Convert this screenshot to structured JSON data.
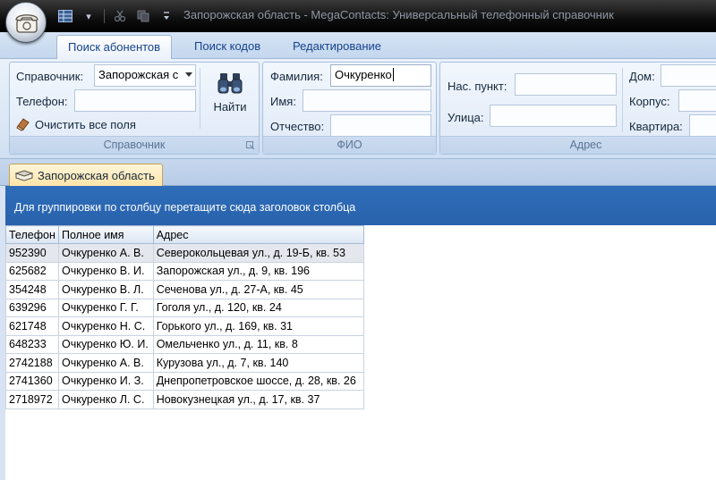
{
  "window": {
    "title": "Запорожская область - MegaContacts: Универсальный телефонный справочник"
  },
  "ribbon_tabs": [
    {
      "label": "Поиск абонентов",
      "active": true
    },
    {
      "label": "Поиск кодов",
      "active": false
    },
    {
      "label": "Редактирование",
      "active": false
    }
  ],
  "groups": {
    "directory": {
      "caption": "Справочник",
      "directory_label": "Справочник:",
      "directory_value": "Запорожская с",
      "phone_label": "Телефон:",
      "phone_value": "",
      "clear_label": "Очистить все поля",
      "find_label": "Найти"
    },
    "fio": {
      "caption": "ФИО",
      "surname_label": "Фамилия:",
      "surname_value": "Очкуренко",
      "name_label": "Имя:",
      "name_value": "",
      "patronymic_label": "Отчество:",
      "patronymic_value": ""
    },
    "address": {
      "caption": "Адрес",
      "locality_label": "Нас. пункт:",
      "locality_value": "",
      "street_label": "Улица:",
      "street_value": "",
      "house_label": "Дом:",
      "building_label": "Корпус:",
      "apartment_label": "Квартира:"
    }
  },
  "document_tab": {
    "label": "Запорожская область"
  },
  "group_panel": {
    "hint": "Для группировки по столбцу перетащите сюда заголовок столбца"
  },
  "grid": {
    "columns": [
      "Телефон",
      "Полное имя",
      "Адрес"
    ],
    "rows": [
      [
        "952390",
        "Очкуренко А. В.",
        "Северокольцевая ул., д. 19-Б, кв. 53"
      ],
      [
        "625682",
        "Очкуренко В. И.",
        "Запорожская ул., д. 9, кв. 196"
      ],
      [
        "354248",
        "Очкуренко В. Л.",
        "Сеченова ул., д. 27-А, кв. 45"
      ],
      [
        "639296",
        "Очкуренко Г. Г.",
        "Гоголя ул., д. 120, кв. 24"
      ],
      [
        "621748",
        "Очкуренко Н. С.",
        "Горького ул., д. 169, кв. 31"
      ],
      [
        "648233",
        "Очкуренко Ю. И.",
        "Омельченко ул., д. 11, кв. 8"
      ],
      [
        "2742188",
        "Очкуренко А. В.",
        "Курузова ул., д. 7, кв. 140"
      ],
      [
        "2741360",
        "Очкуренко И. З.",
        "Днепропетровское шоссе, д. 28, кв. 26"
      ],
      [
        "2718972",
        "Очкуренко Л. С.",
        "Новокузнецкая ул., д. 17, кв. 37"
      ]
    ]
  },
  "colors": {
    "group_panel": "#2962ad",
    "ribbon_text": "#15428b",
    "document_tab": "#ffe3a6"
  },
  "icons": {
    "app_orb": "phone-icon",
    "find": "binoculars-icon",
    "clear": "eraser-icon",
    "document_tab": "book-icon"
  }
}
